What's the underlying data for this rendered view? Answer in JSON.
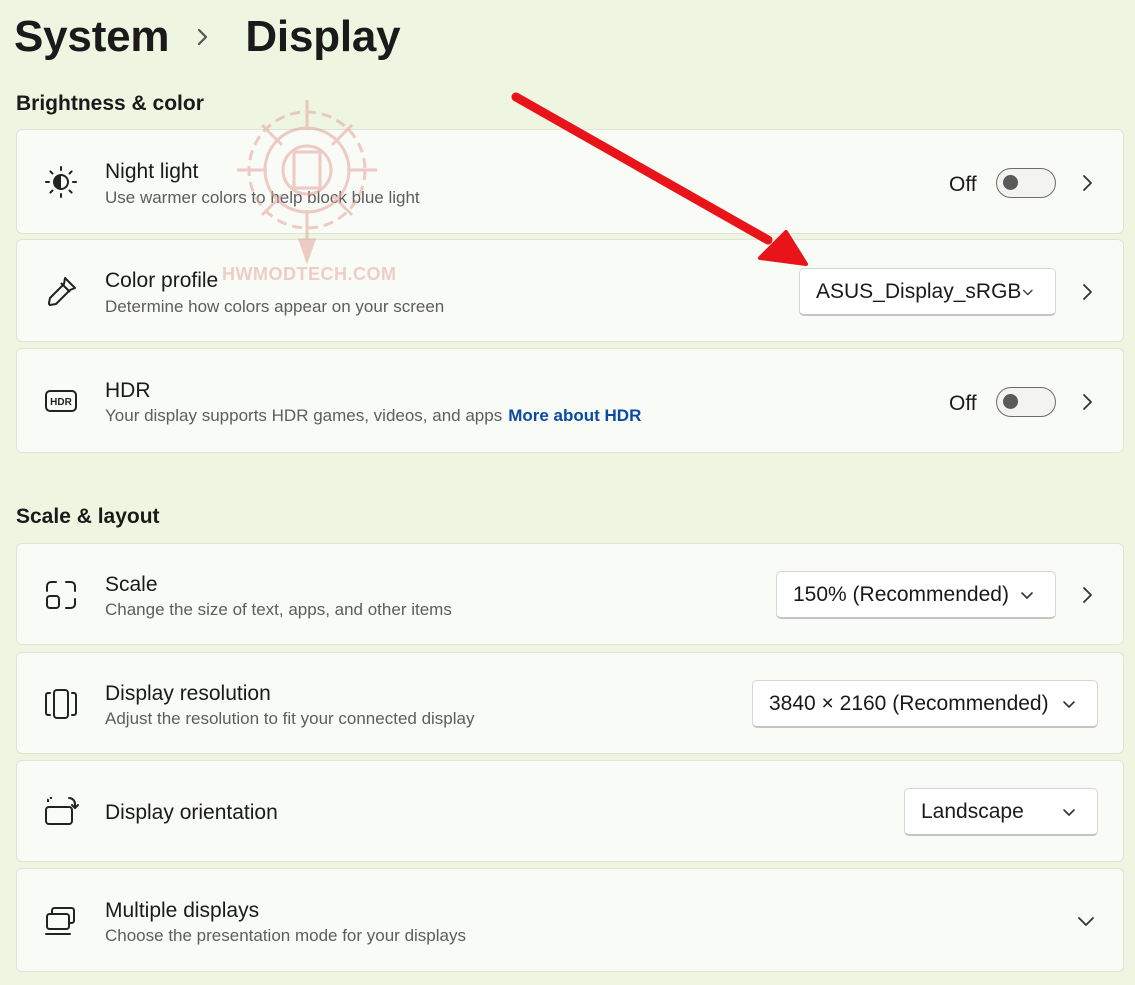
{
  "breadcrumb": {
    "parent": "System",
    "current": "Display"
  },
  "sections": {
    "brightness": "Brightness & color",
    "scale": "Scale & layout"
  },
  "night_light": {
    "title": "Night light",
    "desc": "Use warmer colors to help block blue light",
    "state": "Off",
    "icon": "sun-moon-icon"
  },
  "color_profile": {
    "title": "Color profile",
    "desc": "Determine how colors appear on your screen",
    "value": "ASUS_Display_sRGB",
    "icon": "eyedropper-icon"
  },
  "hdr": {
    "title": "HDR",
    "desc": "Your display supports HDR games, videos, and apps",
    "link": "More about HDR",
    "state": "Off",
    "icon": "hdr-icon"
  },
  "scale": {
    "title": "Scale",
    "desc": "Change the size of text, apps, and other items",
    "value": "150% (Recommended)",
    "icon": "scale-icon"
  },
  "resolution": {
    "title": "Display resolution",
    "desc": "Adjust the resolution to fit your connected display",
    "value": "3840 × 2160 (Recommended)",
    "icon": "resolution-icon"
  },
  "orientation": {
    "title": "Display orientation",
    "value": "Landscape",
    "icon": "orientation-icon"
  },
  "multiple": {
    "title": "Multiple displays",
    "desc": "Choose the presentation mode for your displays",
    "icon": "multiple-displays-icon"
  },
  "watermark": {
    "text": "HWMODTECH.COM"
  },
  "colors": {
    "background": "#eef6e2",
    "card": "#f9fbf6",
    "link": "#0b4aa2",
    "annotation_arrow": "#e8141a"
  }
}
